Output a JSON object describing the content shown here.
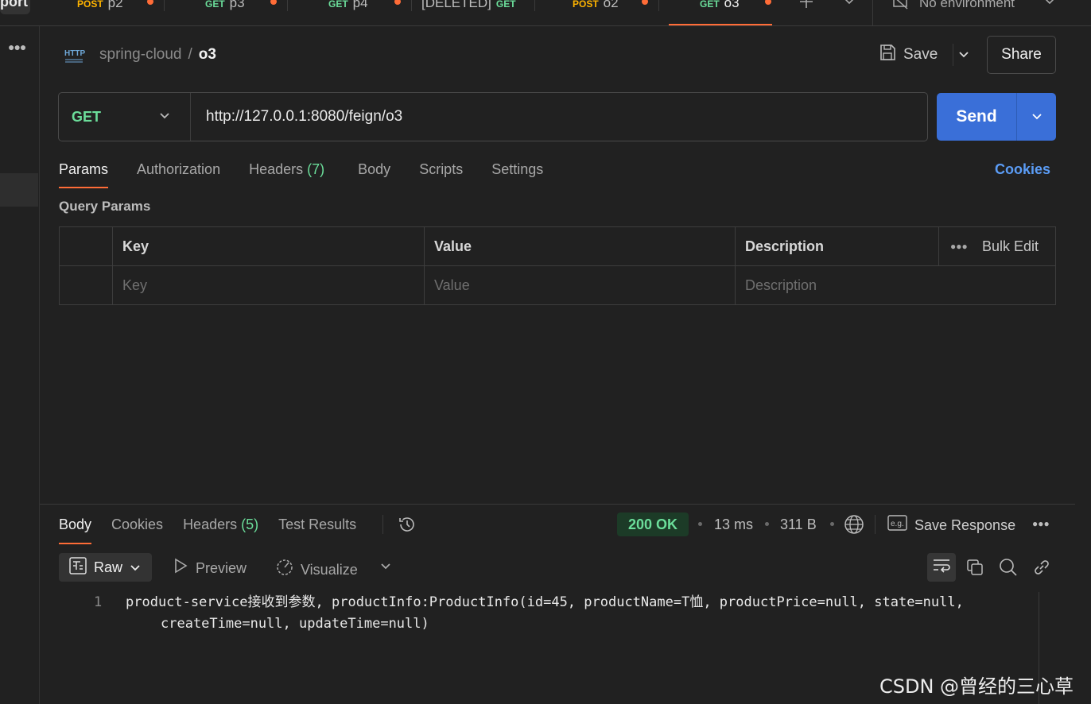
{
  "tabs": {
    "sidebar_partial": "port",
    "items": [
      {
        "method": "POST",
        "name": "p2"
      },
      {
        "method": "GET",
        "name": "p3"
      },
      {
        "method": "GET",
        "name": "p4"
      },
      {
        "method": "GET",
        "name": "[DELETED]"
      },
      {
        "method": "POST",
        "name": "o2"
      },
      {
        "method": "GET",
        "name": "o3"
      }
    ],
    "environment": "No environment"
  },
  "header": {
    "collection": "spring-cloud",
    "separator": "/",
    "request_name": "o3",
    "save_label": "Save",
    "share_label": "Share"
  },
  "request": {
    "method": "GET",
    "url": "http://127.0.0.1:8080/feign/o3",
    "send_label": "Send",
    "tabs": {
      "params": "Params",
      "authorization": "Authorization",
      "headers": "Headers",
      "headers_count": "(7)",
      "body": "Body",
      "scripts": "Scripts",
      "settings": "Settings"
    },
    "cookies_label": "Cookies"
  },
  "query_params": {
    "title": "Query Params",
    "headers": {
      "key": "Key",
      "value": "Value",
      "description": "Description",
      "bulk_edit": "Bulk Edit"
    },
    "placeholders": {
      "key": "Key",
      "value": "Value",
      "description": "Description"
    }
  },
  "response": {
    "tabs": {
      "body": "Body",
      "cookies": "Cookies",
      "headers": "Headers",
      "headers_count": "(5)",
      "test_results": "Test Results"
    },
    "status": "200 OK",
    "time": "13 ms",
    "size": "311 B",
    "save_response_label": "Save Response",
    "format_label": "Raw",
    "preview_label": "Preview",
    "visualize_label": "Visualize",
    "line_number": "1",
    "body_line1": "product-service接收到参数, productInfo:ProductInfo(id=45, productName=T恤, productPrice=null, state=null,",
    "body_line2": "createTime=null, updateTime=null)"
  },
  "watermark": "CSDN @曾经的三心草",
  "colors": {
    "accent": "#ff6c37",
    "send": "#3a6fd8",
    "get": "#6bdd9a",
    "post": "#ffb400",
    "link": "#5b9cf5",
    "status_ok_bg": "#1c3b27"
  }
}
